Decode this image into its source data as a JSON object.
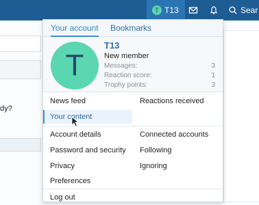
{
  "header": {
    "user_initial": "T",
    "user_name": "T13",
    "search_label": "Sear"
  },
  "background": {
    "partial_text": "dy?"
  },
  "popup": {
    "tabs": [
      "Your account",
      "Bookmarks"
    ],
    "profile": {
      "initial": "T",
      "name": "T13",
      "title": "New member",
      "stats": [
        {
          "label": "Messages:",
          "value": "3"
        },
        {
          "label": "Reaction score:",
          "value": "1"
        },
        {
          "label": "Trophy points:",
          "value": "3"
        }
      ]
    },
    "menu_left": [
      "News feed",
      "Your content",
      "Account details",
      "Password and security",
      "Privacy",
      "Preferences",
      "Log out"
    ],
    "menu_right": [
      "Reactions received",
      "Connected accounts",
      "Following",
      "Ignoring"
    ]
  },
  "colors": {
    "topbar": "#1d5d94",
    "accent": "#3b8fd4",
    "avatar": "#5ad6b0"
  }
}
